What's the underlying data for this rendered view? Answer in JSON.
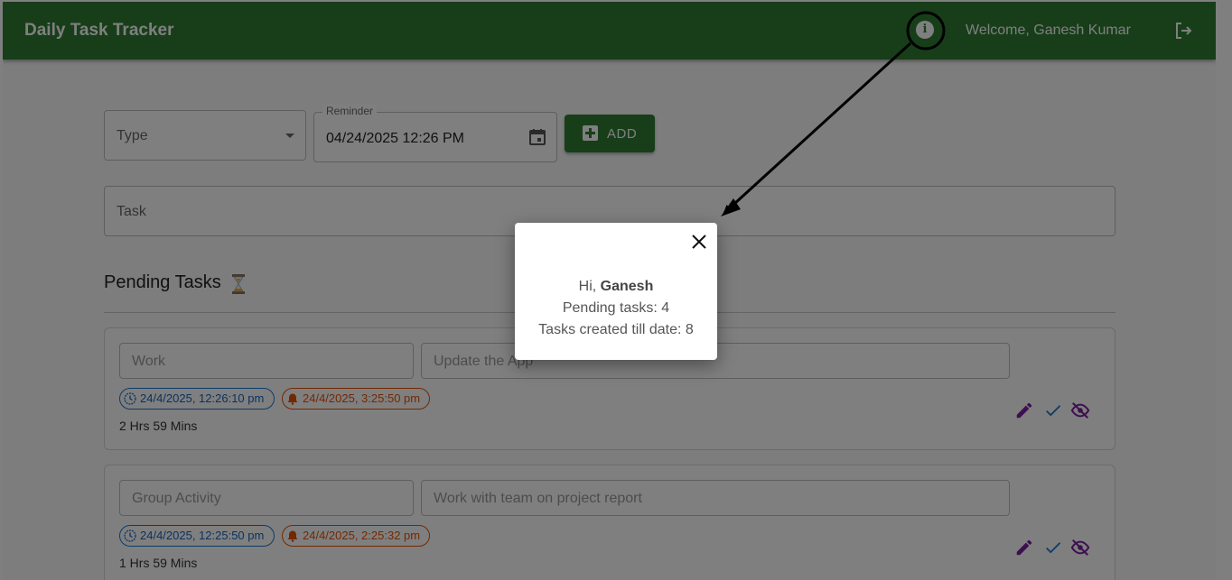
{
  "appbar": {
    "title": "Daily Task Tracker",
    "welcome": "Welcome, Ganesh Kumar",
    "info_icon": "info-icon",
    "logout_icon": "logout-icon",
    "color": "#2e7d32"
  },
  "form": {
    "type_placeholder": "Type",
    "reminder_label": "Reminder",
    "reminder_value": "04/24/2025 12:26 PM",
    "add_label": "ADD",
    "task_placeholder": "Task"
  },
  "pending": {
    "title": "Pending Tasks",
    "tasks": [
      {
        "type": "Work",
        "task": "Update the App",
        "created": "24/4/2025, 12:26:10 pm",
        "reminder": "24/4/2025, 3:25:50 pm",
        "duration": "2 Hrs 59 Mins"
      },
      {
        "type": "Group Activity",
        "task": "Work with team on project report",
        "created": "24/4/2025, 12:25:50 pm",
        "reminder": "24/4/2025, 2:25:32 pm",
        "duration": "1 Hrs 59 Mins"
      }
    ]
  },
  "dialog": {
    "greeting": "Hi,",
    "name": "Ganesh",
    "pending_text": "Pending tasks: 4",
    "created_text": "Tasks created till date: 8"
  },
  "colors": {
    "created_chip": "#1976d2",
    "reminder_chip": "#e65100",
    "action_purple": "#7b1fa2",
    "action_blue": "#1976d2"
  }
}
